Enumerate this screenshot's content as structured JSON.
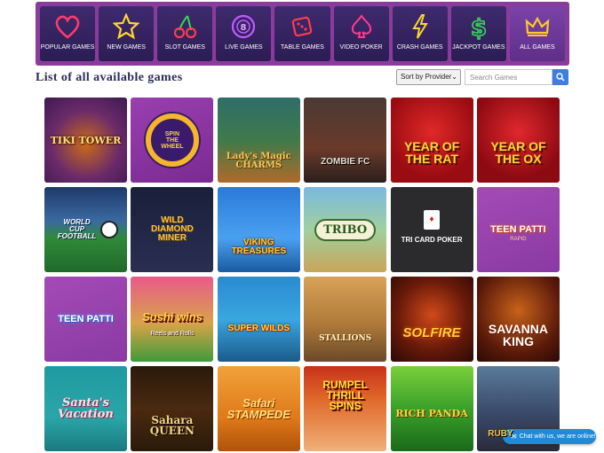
{
  "categories": [
    {
      "label": "POPULAR GAMES",
      "icon": "heart-icon"
    },
    {
      "label": "NEW GAMES",
      "icon": "star-icon"
    },
    {
      "label": "SLOT GAMES",
      "icon": "cherry-icon"
    },
    {
      "label": "LIVE GAMES",
      "icon": "roulette-chip-icon"
    },
    {
      "label": "TABLE GAMES",
      "icon": "dice-icon"
    },
    {
      "label": "VIDEO POKER",
      "icon": "spade-icon"
    },
    {
      "label": "CRASH GAMES",
      "icon": "lightning-icon"
    },
    {
      "label": "JACKPOT GAMES",
      "icon": "dollar-icon"
    },
    {
      "label": "ALL GAMES",
      "icon": "crown-icon"
    }
  ],
  "page_title": "List of all available games",
  "sort": {
    "selected": "Sort by Provider"
  },
  "search": {
    "placeholder": "Search Games"
  },
  "games": [
    {
      "title": "TIKI TOWER",
      "subtitle": ""
    },
    {
      "title": "SPIN THE WHEEL",
      "subtitle": ""
    },
    {
      "title": "Lady's Magic CHARMS",
      "subtitle": ""
    },
    {
      "title": "ZOMBIE FC",
      "subtitle": ""
    },
    {
      "title": "YEAR OF THE RAT",
      "subtitle": ""
    },
    {
      "title": "YEAR OF THE OX",
      "subtitle": ""
    },
    {
      "title": "WORLD CUP FOOTBALL",
      "subtitle": ""
    },
    {
      "title": "WILD DIAMOND MINER",
      "subtitle": ""
    },
    {
      "title": "VIKING TREASURES",
      "subtitle": ""
    },
    {
      "title": "TRIBO",
      "subtitle": ""
    },
    {
      "title": "TRI CARD POKER",
      "subtitle": ""
    },
    {
      "title": "TEEN PATTI",
      "subtitle": "RAPID"
    },
    {
      "title": "TEEN PATTI",
      "subtitle": ""
    },
    {
      "title": "Sushi wins",
      "subtitle": "Reels and Rolls"
    },
    {
      "title": "SUPER WILDS",
      "subtitle": ""
    },
    {
      "title": "STALLIONS",
      "subtitle": ""
    },
    {
      "title": "SOLFIRE",
      "subtitle": ""
    },
    {
      "title": "SAVANNA KING",
      "subtitle": ""
    },
    {
      "title": "Santa's Vacation",
      "subtitle": ""
    },
    {
      "title": "Sahara QUEEN",
      "subtitle": ""
    },
    {
      "title": "Safari STAMPEDE",
      "subtitle": ""
    },
    {
      "title": "RUMPEL THRILL SPINS",
      "subtitle": ""
    },
    {
      "title": "RICH PANDA",
      "subtitle": ""
    },
    {
      "title": "RUBY",
      "subtitle": ""
    }
  ],
  "chat": {
    "label": "Chat with us, we are online!"
  }
}
